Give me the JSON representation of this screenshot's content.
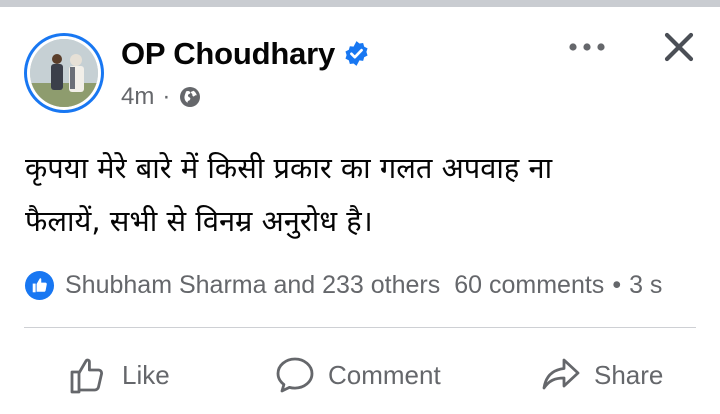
{
  "post": {
    "author": "OP Choudhary",
    "time": "4m",
    "separator": "·",
    "text_line1": "कृपया मेरे बारे में किसी प्रकार का गलत अपवाह ना",
    "text_line2": "फैलायें, सभी से विनम्र अनुरोध है।"
  },
  "reactions": {
    "likers": "Shubham Sharma and 233 others",
    "comments": "60 comments",
    "separator": "•",
    "shares": "3 s"
  },
  "actions": {
    "like": "Like",
    "comment": "Comment",
    "share": "Share"
  },
  "icons": {
    "verified": "verified-badge-icon",
    "audience": "globe-icon",
    "more": "more-options-icon",
    "close": "close-icon",
    "like_reaction": "like-reaction-icon",
    "like": "thumbs-up-icon",
    "comment": "comment-bubble-icon",
    "share": "share-arrow-icon"
  },
  "colors": {
    "brand_blue": "#1877f2",
    "secondary_text": "#65676b",
    "primary_text": "#050505",
    "divider": "#ced0d4"
  }
}
